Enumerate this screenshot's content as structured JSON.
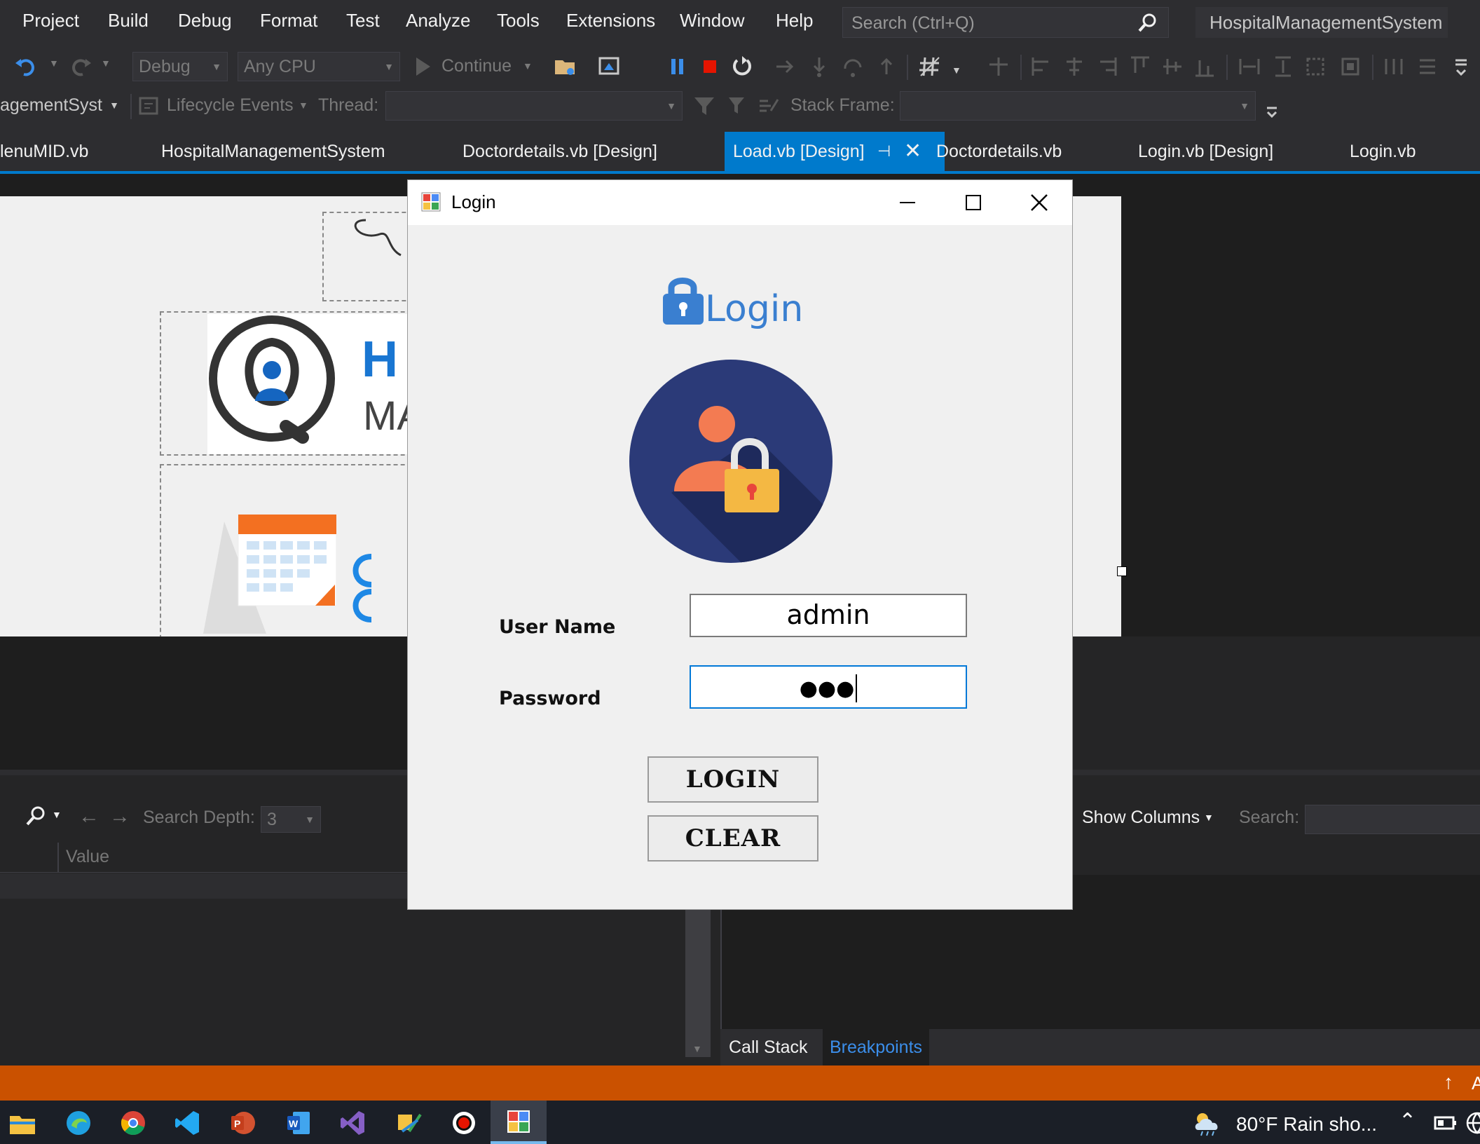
{
  "menu": {
    "items": [
      "Project",
      "Build",
      "Debug",
      "Format",
      "Test",
      "Analyze",
      "Tools",
      "Extensions",
      "Window",
      "Help"
    ],
    "search_placeholder": "Search (Ctrl+Q)",
    "project_name": "HospitalManagementSystem"
  },
  "toolbar": {
    "config": "Debug",
    "platform": "Any CPU",
    "continue_label": "Continue",
    "project_combo": "agementSyst",
    "lifecycle_label": "Lifecycle Events",
    "thread_label": "Thread:",
    "stack_frame_label": "Stack Frame:"
  },
  "tabs": [
    {
      "label": "lenuMID.vb"
    },
    {
      "label": "HospitalManagementSystem"
    },
    {
      "label": "Doctordetails.vb [Design]"
    },
    {
      "label": "Load.vb [Design]",
      "active": true
    },
    {
      "label": "Doctordetails.vb"
    },
    {
      "label": "Login.vb [Design]"
    },
    {
      "label": "Login.vb"
    }
  ],
  "designer": {
    "logo_letter_1": "H",
    "logo_letter_2": "MA"
  },
  "locals": {
    "search_depth_label": "Search Depth:",
    "search_depth_value": "3",
    "value_header": "Value"
  },
  "breakpoints": {
    "show_columns_label": "Show Columns",
    "search_label": "Search:",
    "bottom_tabs": [
      "Call Stack",
      "Breakpoints"
    ]
  },
  "login_window": {
    "title": "Login",
    "heading": "Login",
    "username_label": "User Name",
    "username_value": "admin",
    "password_label": "Password",
    "password_value": "●●●",
    "login_button": "LOGIN",
    "clear_button": "CLEAR"
  },
  "taskbar": {
    "weather": "80°F  Rain sho...",
    "corner_letter": "A"
  },
  "colors": {
    "accent": "#007acc",
    "statusbar": "#ca5100",
    "login_heading": "#3a7fd0",
    "avatar_circle": "#2b3a78"
  }
}
